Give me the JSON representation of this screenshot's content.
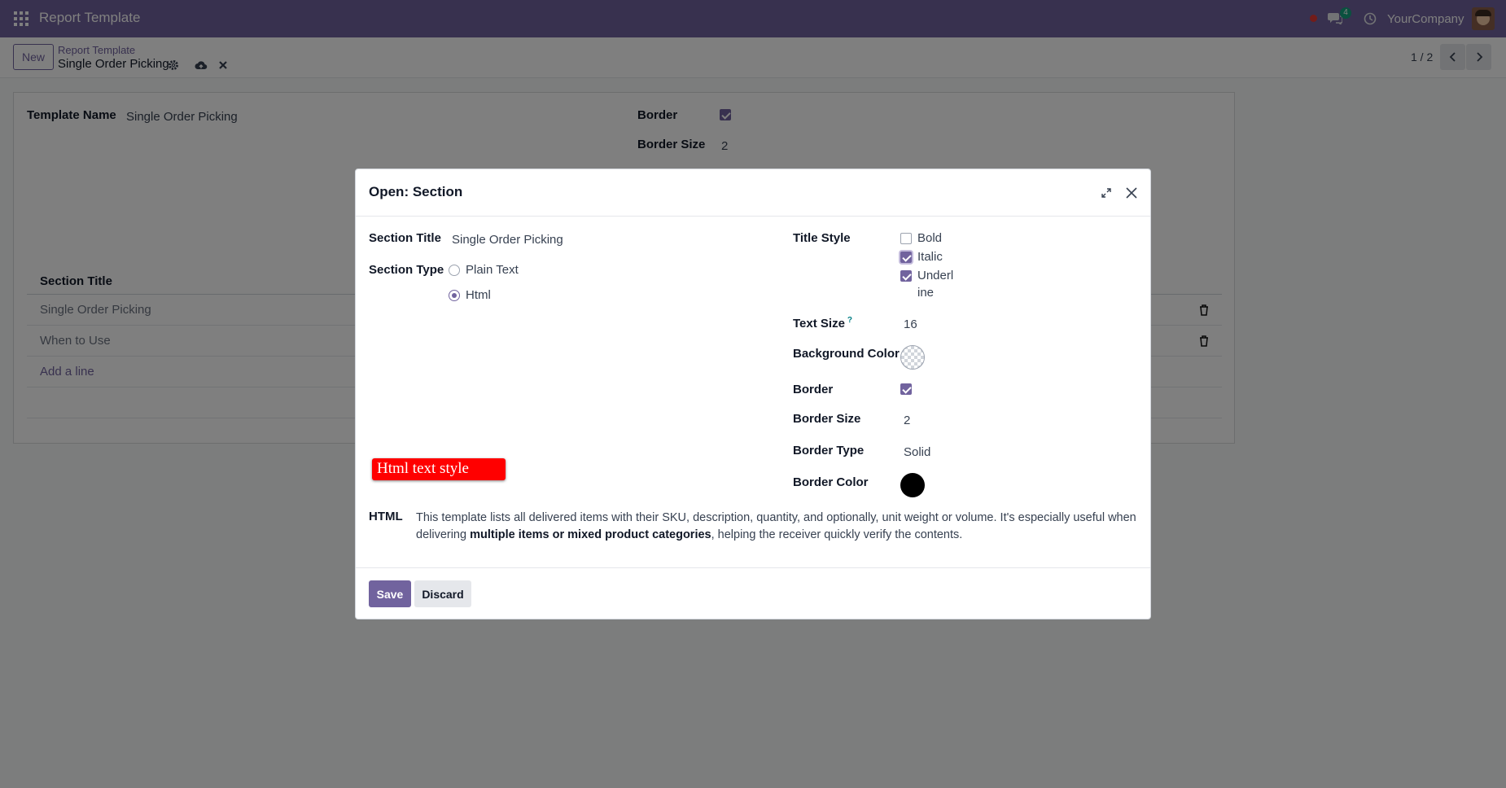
{
  "navbar": {
    "app_title": "Report Template",
    "chat_count": "4",
    "company": "YourCompany"
  },
  "control": {
    "new_label": "New",
    "breadcrumb_parent": "Report Template",
    "breadcrumb_current": "Single Order Picking",
    "pager": "1 / 2"
  },
  "form": {
    "template_name_label": "Template Name",
    "template_name_value": "Single Order Picking",
    "border_label": "Border",
    "border_checked": true,
    "border_size_label": "Border Size",
    "border_size_value": "2",
    "list_header": "Section Title",
    "rows": [
      "Single Order Picking",
      "When to Use"
    ],
    "add_line": "Add a line"
  },
  "modal": {
    "title": "Open: Section",
    "section_title_label": "Section Title",
    "section_title_value": "Single Order Picking",
    "section_type_label": "Section Type",
    "section_type_options": [
      "Plain Text",
      "Html"
    ],
    "section_type_selected": "Html",
    "title_style_label": "Title Style",
    "title_style_options": [
      {
        "label": "Bold",
        "checked": false
      },
      {
        "label": "Italic",
        "checked": true
      },
      {
        "label": "Underl",
        "label_cont": "ine",
        "checked": true
      }
    ],
    "text_size_label": "Text Size",
    "text_size_help": "?",
    "text_size_value": "16",
    "background_color_label": "Background Color",
    "border_label": "Border",
    "border_checked": true,
    "border_size_label": "Border Size",
    "border_size_value": "2",
    "border_type_label": "Border Type",
    "border_type_value": "Solid",
    "border_color_label": "Border Color",
    "border_color": "#000000",
    "html_preview_text": "Html text style",
    "html_preview_color": "#ff0000",
    "html_label": "HTML",
    "html_text_1": "This template lists all delivered items with their SKU, description, quantity, and optionally, unit weight or volume. It's especially useful when delivering ",
    "html_text_bold": "multiple items or mixed product categories",
    "html_text_2": ", helping the receiver quickly verify the contents.",
    "save_label": "Save",
    "discard_label": "Discard"
  },
  "colors": {
    "brand": "#71639e",
    "badge": "#14a37f"
  }
}
